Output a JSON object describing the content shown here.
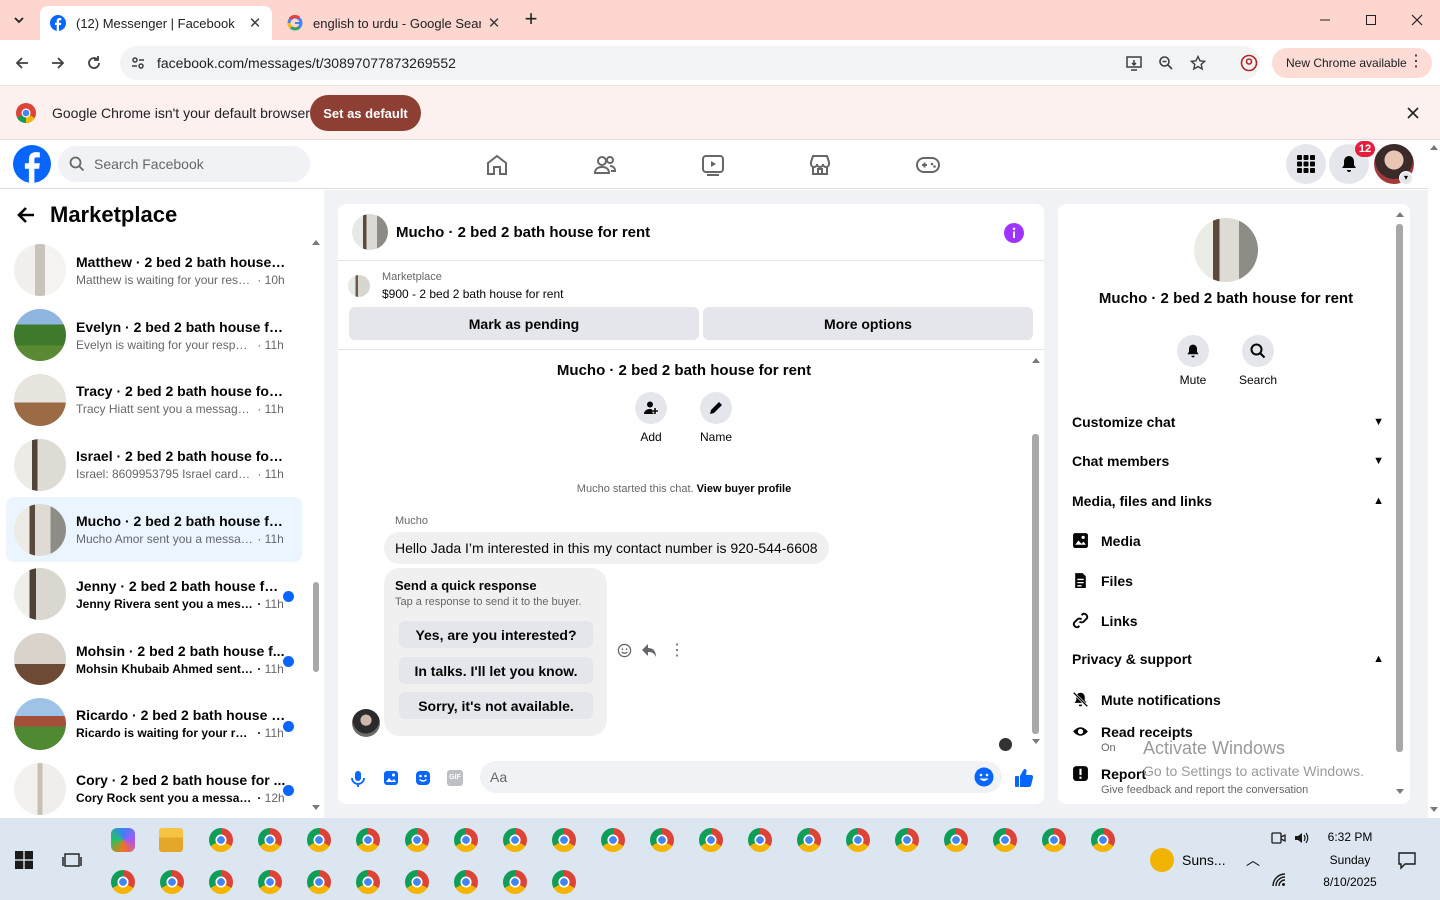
{
  "browser": {
    "tabs": [
      {
        "title": "(12) Messenger | Facebook",
        "active": true
      },
      {
        "title": "english to urdu - Google Search",
        "active": false
      }
    ],
    "url": "facebook.com/messages/t/30897077873269552",
    "update_label": "New Chrome available",
    "infobar_text": "Google Chrome isn't your default browser",
    "set_default_label": "Set as default"
  },
  "facebook": {
    "search_placeholder": "Search Facebook",
    "notification_count": "12",
    "nav_icons": [
      "home-icon",
      "friends-icon",
      "video-icon",
      "marketplace-icon",
      "gaming-icon"
    ]
  },
  "sidebar": {
    "title": "Marketplace",
    "conversations": [
      {
        "title": "Matthew · 2 bed 2 bath house f...",
        "preview": "Matthew is waiting for your respo...",
        "time": "10h",
        "unread": false,
        "selected": false
      },
      {
        "title": "Evelyn · 2 bed 2 bath house for ...",
        "preview": "Evelyn is waiting for your response.",
        "time": "11h",
        "unread": false,
        "selected": false
      },
      {
        "title": "Tracy · 2 bed 2 bath house for re...",
        "preview": "Tracy Hiatt sent you a message ab...",
        "time": "11h",
        "unread": false,
        "selected": false
      },
      {
        "title": "Israel · 2 bed 2 bath house for r...",
        "preview": "Israel: 8609953795 Israel cardona ...",
        "time": "11h",
        "unread": false,
        "selected": false
      },
      {
        "title": "Mucho · 2 bed 2 bath house for ...",
        "preview": "Mucho Amor sent you a message ...",
        "time": "11h",
        "unread": false,
        "selected": true
      },
      {
        "title": "Jenny · 2 bed 2 bath house for...",
        "preview": "Jenny Rivera sent you a messa...",
        "time": "11h",
        "unread": true,
        "selected": false
      },
      {
        "title": "Mohsin · 2 bed 2 bath house f...",
        "preview": "Mohsin Khubaib Ahmed sent y...",
        "time": "11h",
        "unread": true,
        "selected": false
      },
      {
        "title": "Ricardo · 2 bed 2 bath house f...",
        "preview": "Ricardo is waiting for your res...",
        "time": "11h",
        "unread": true,
        "selected": false
      },
      {
        "title": "Cory · 2 bed 2 bath house for ...",
        "preview": "Cory Rock sent you a message ...",
        "time": "12h",
        "unread": true,
        "selected": false
      }
    ]
  },
  "chat": {
    "header_title": "Mucho · 2 bed 2 bath house for rent",
    "marketplace_label": "Marketplace",
    "listing": "$900 - 2 bed 2 bath house for rent",
    "mark_pending_label": "Mark as pending",
    "more_options_label": "More options",
    "intro_title": "Mucho · 2 bed 2 bath house for rent",
    "add_label": "Add",
    "name_label": "Name",
    "started_text": "Mucho started this chat.",
    "view_profile_label": "View buyer profile",
    "sender": "Mucho",
    "message": "Hello Jada I’m interested in this my contact number is 920-544-6608",
    "quick_title": "Send a quick response",
    "quick_subtitle": "Tap a response to send it to the buyer.",
    "quick_responses": [
      "Yes, are you interested?",
      "In talks. I'll let you know.",
      "Sorry, it's not available."
    ],
    "input_placeholder": "Aa"
  },
  "details": {
    "title": "Mucho · 2 bed 2 bath house for rent",
    "mute_label": "Mute",
    "search_label": "Search",
    "customize_chat": "Customize chat",
    "chat_members": "Chat members",
    "media_section": "Media, files and links",
    "media": "Media",
    "files": "Files",
    "links": "Links",
    "privacy_section": "Privacy & support",
    "mute_notifications": "Mute notifications",
    "read_receipts": "Read receipts",
    "read_receipts_status": "On",
    "report": "Report",
    "report_sub": "Give feedback and report the conversation"
  },
  "watermark": {
    "line1": "Activate Windows",
    "line2": "Go to Settings to activate Windows."
  },
  "taskbar": {
    "weather": "Suns...",
    "time": "6:32 PM",
    "day": "Sunday",
    "date": "8/10/2025"
  }
}
